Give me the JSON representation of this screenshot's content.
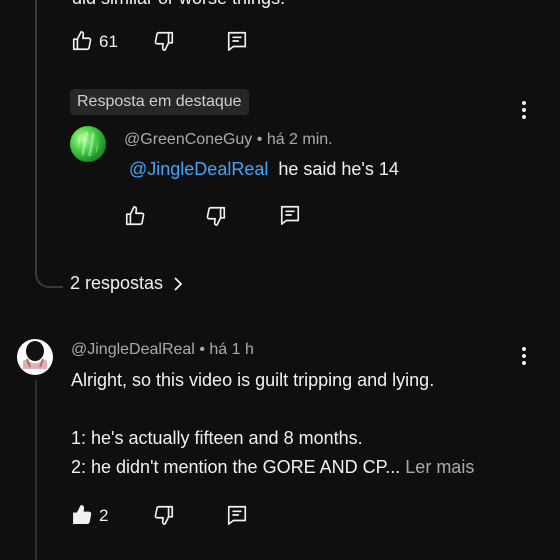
{
  "top_comment": {
    "partial_text": "did similar or worse things.",
    "like_count": "61"
  },
  "highlighted_reply": {
    "badge": "Resposta em destaque",
    "author": "@GreenConeGuy",
    "time": "há 2 min.",
    "mention": "@JingleDealReal",
    "text": "he said he's 14"
  },
  "replies_link": "2 respostas",
  "comment": {
    "author": "@JingleDealReal",
    "time": "há 1 h",
    "line1": "Alright, so this video is guilt tripping and lying.",
    "line2": "1: he's actually fifteen and 8 months.",
    "line3": "2: he didn't mention the GORE AND CP...",
    "read_more": "Ler mais",
    "like_count": "2"
  },
  "icons": {
    "like": "thumbs-up-icon",
    "dislike": "thumbs-down-icon",
    "reply": "reply-icon",
    "more": "more-vert-icon",
    "chevron": "chevron-right-icon"
  },
  "colors": {
    "background": "#0f0f0f",
    "text": "#f1f1f1",
    "muted": "#aaaaaa",
    "mention": "#3ea6ff",
    "badge_bg": "#272727"
  }
}
